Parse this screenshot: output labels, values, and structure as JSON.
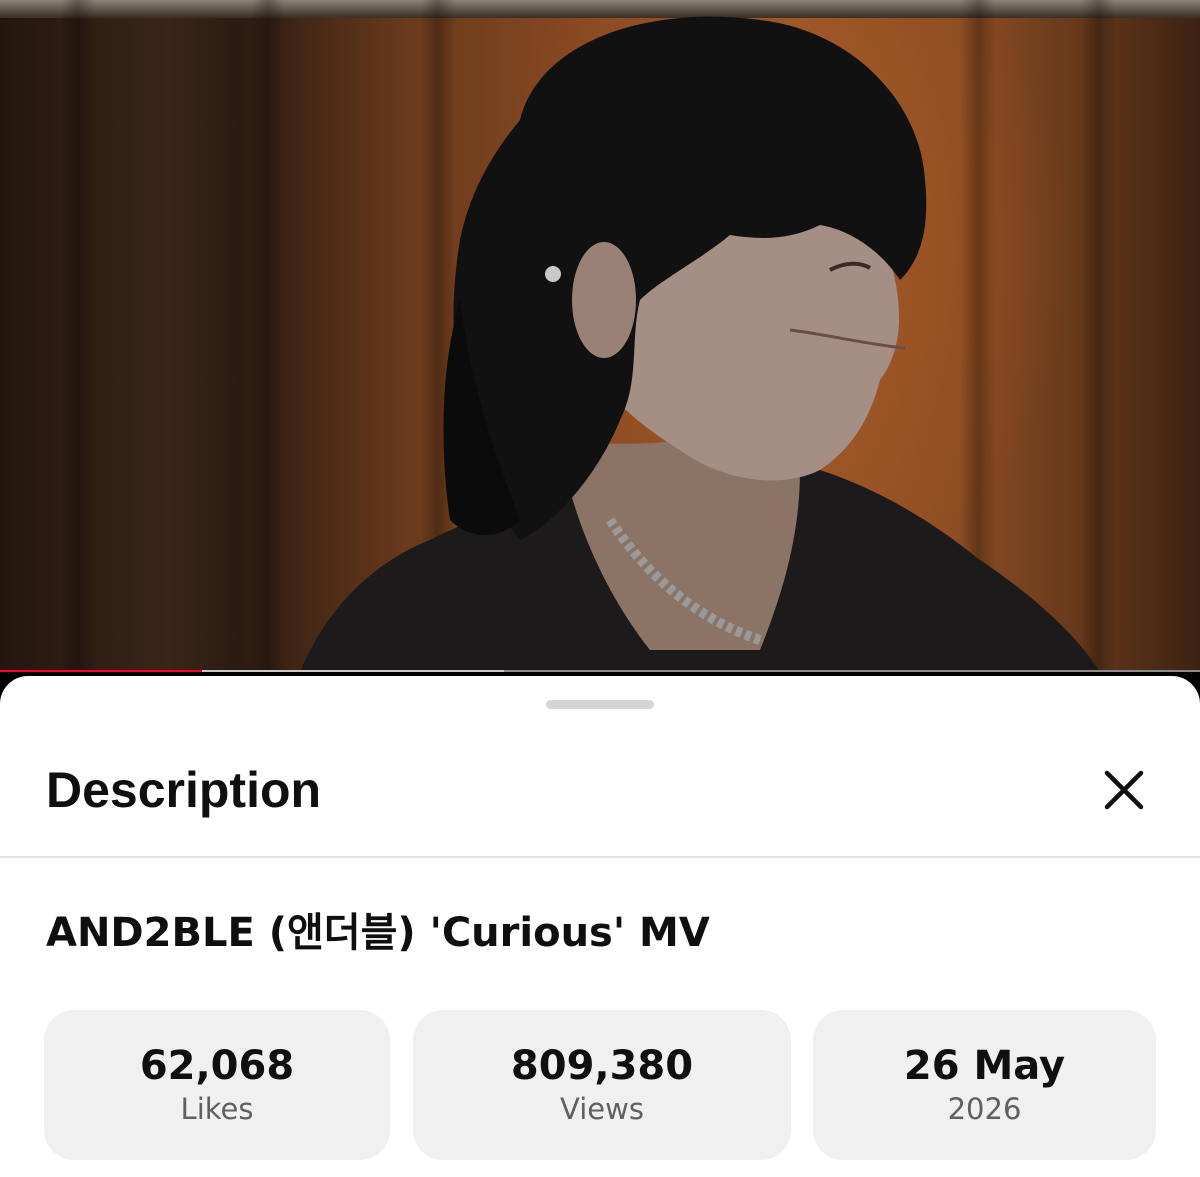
{
  "player": {
    "progress_played": 0.168,
    "progress_buffered": 0.42,
    "accent_color": "#ff0033"
  },
  "sheet": {
    "title": "Description",
    "close_icon": "close-icon"
  },
  "video": {
    "title": "AND2BLE (앤더블) 'Curious' MV"
  },
  "stats": [
    {
      "value": "62,068",
      "label": "Likes"
    },
    {
      "value": "809,380",
      "label": "Views"
    },
    {
      "value": "26 May",
      "label": "2026"
    }
  ]
}
